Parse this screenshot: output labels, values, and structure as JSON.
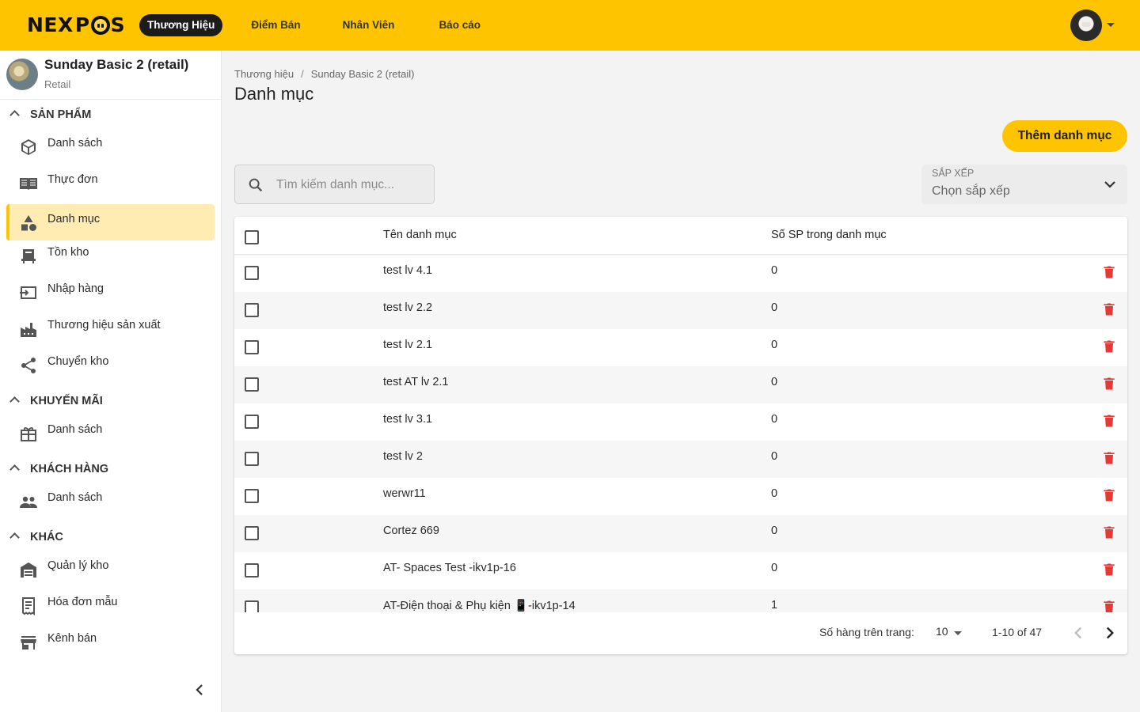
{
  "topbar": {
    "logo": "NEXPOS",
    "tabs": [
      {
        "label": "Thương Hiệu",
        "active": true
      },
      {
        "label": "Điểm Bán",
        "active": false
      },
      {
        "label": "Nhân Viên",
        "active": false
      },
      {
        "label": "Báo cáo",
        "active": false
      }
    ]
  },
  "store": {
    "name": "Sunday Basic 2 (retail)",
    "type": "Retail"
  },
  "sidebar": {
    "sections": [
      {
        "label": "SẢN PHẨM",
        "items": [
          {
            "label": "Danh sách",
            "icon": "box-icon"
          },
          {
            "label": "Thực đơn",
            "icon": "menu-book-icon"
          },
          {
            "label": "Danh mục",
            "icon": "category-icon",
            "active": true
          },
          {
            "label": "Tồn kho",
            "icon": "inventory-icon"
          },
          {
            "label": "Nhập hàng",
            "icon": "import-icon"
          },
          {
            "label": "Thương hiệu sản xuất",
            "icon": "factory-icon"
          },
          {
            "label": "Chuyển kho",
            "icon": "share-icon"
          }
        ]
      },
      {
        "label": "KHUYẾN MÃI",
        "items": [
          {
            "label": "Danh sách",
            "icon": "gift-icon"
          }
        ]
      },
      {
        "label": "KHÁCH HÀNG",
        "items": [
          {
            "label": "Danh sách",
            "icon": "people-icon"
          }
        ]
      },
      {
        "label": "KHÁC",
        "items": [
          {
            "label": "Quản lý kho",
            "icon": "warehouse-icon"
          },
          {
            "label": "Hóa đơn mẫu",
            "icon": "receipt-icon"
          },
          {
            "label": "Kênh bán",
            "icon": "store-icon"
          }
        ]
      }
    ]
  },
  "breadcrumb": [
    "Thương hiệu",
    "Sunday Basic 2 (retail)"
  ],
  "breadcrumb_sep": "/",
  "page": {
    "title": "Danh mục",
    "add_button": "Thêm danh mục"
  },
  "search": {
    "placeholder": "Tìm kiếm danh mục...",
    "value": ""
  },
  "sort": {
    "label": "SẮP XẾP",
    "value": "Chọn sắp xếp"
  },
  "table": {
    "headers": {
      "name": "Tên danh mục",
      "count": "Số SP trong danh mục"
    },
    "rows": [
      {
        "name": "test lv 4.1",
        "count": "0"
      },
      {
        "name": "test lv 2.2",
        "count": "0"
      },
      {
        "name": "test lv 2.1",
        "count": "0"
      },
      {
        "name": "test AT lv 2.1",
        "count": "0"
      },
      {
        "name": "test lv 3.1",
        "count": "0"
      },
      {
        "name": "test lv 2",
        "count": "0"
      },
      {
        "name": "werwr11",
        "count": "0"
      },
      {
        "name": "Cortez 669",
        "count": "0"
      },
      {
        "name": "AT- Spaces Test -ikv1p-16",
        "count": "0"
      },
      {
        "name": "AT-Điện thoại & Phụ kiện 📱-ikv1p-14",
        "count": "1"
      }
    ]
  },
  "pagination": {
    "rows_per_page_label": "Số hàng trên trang:",
    "rows_per_page": "10",
    "range": "1-10 of 47"
  },
  "colors": {
    "brand": "#ffc400",
    "active_bg": "#ffecb3",
    "delete": "#e53935"
  }
}
